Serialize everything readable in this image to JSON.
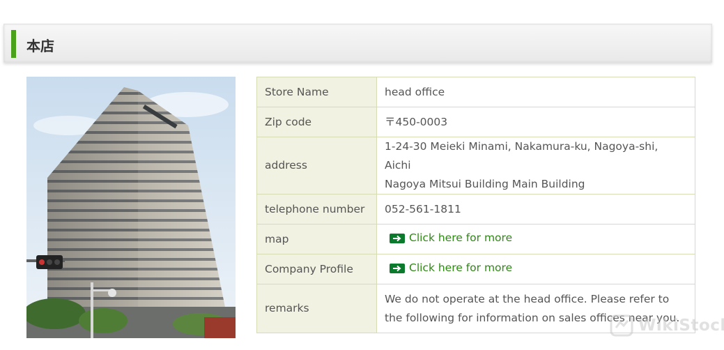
{
  "section": {
    "title": "本店"
  },
  "store_table": {
    "rows": [
      {
        "label": "Store Name",
        "value": "head office"
      },
      {
        "label": "Zip code",
        "value": "〒450-0003"
      },
      {
        "label": "address",
        "value_line1": "1-24-30 Meieki Minami, Nakamura-ku, Nagoya-shi, Aichi",
        "value_line2": "Nagoya Mitsui Building Main Building"
      },
      {
        "label": "telephone number",
        "value": "052-561-1811"
      },
      {
        "label": "map",
        "link_text": "Click here for more"
      },
      {
        "label": "Company Profile",
        "link_text": "Click here for more"
      },
      {
        "label": "remarks",
        "value": "We do not operate at the head office. Please refer to the following for information on sales offices near you."
      }
    ]
  },
  "watermark": {
    "text": "WikiStock"
  },
  "colors": {
    "accent": "#4aa21a",
    "label_bg": "#f1f2e1",
    "border": "#d6dcb3",
    "link": "#2d8a13",
    "arrow_bg": "#0c7a2c"
  },
  "icons": {
    "link_arrow": "arrow-right-icon",
    "watermark_logo": "wikistock-logo"
  }
}
